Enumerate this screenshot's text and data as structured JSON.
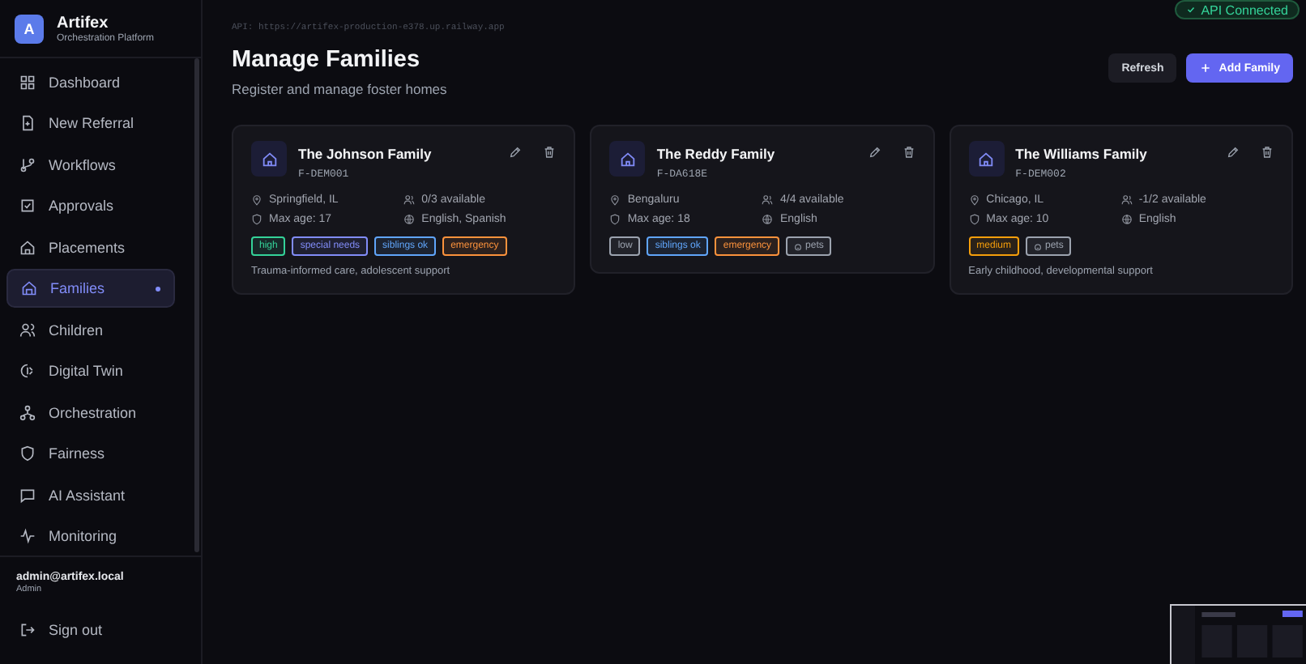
{
  "brand": {
    "letter": "A",
    "name": "Artifex",
    "subtitle": "Orchestration Platform"
  },
  "nav": [
    {
      "label": "Dashboard",
      "selected": false
    },
    {
      "label": "New Referral",
      "selected": false
    },
    {
      "label": "Workflows",
      "selected": false
    },
    {
      "label": "Approvals",
      "selected": false
    },
    {
      "label": "Placements",
      "selected": false
    },
    {
      "label": "Families",
      "selected": true
    },
    {
      "label": "Children",
      "selected": false
    },
    {
      "label": "Digital Twin",
      "selected": false
    },
    {
      "label": "Orchestration",
      "selected": false
    },
    {
      "label": "Fairness",
      "selected": false
    },
    {
      "label": "AI Assistant",
      "selected": false
    },
    {
      "label": "Monitoring",
      "selected": false
    }
  ],
  "user": {
    "email": "admin@artifex.local",
    "role": "Admin"
  },
  "sign_out": "Sign out",
  "api_url": "API: https://artifex-production-e378.up.railway.app",
  "api_status": "API Connected",
  "page": {
    "title": "Manage Families",
    "subtitle": "Register and manage foster homes"
  },
  "buttons": {
    "refresh": "Refresh",
    "add": "Add Family"
  },
  "families": [
    {
      "name": "The Johnson Family",
      "code": "F-DEM001",
      "location": "Springfield, IL",
      "availability": "0/3 available",
      "max_age": "Max age: 17",
      "languages": "English, Spanish",
      "tags": [
        {
          "label": "high",
          "color": "#34d399",
          "kind": "plain"
        },
        {
          "label": "special needs",
          "color": "#818cf8",
          "kind": "plain"
        },
        {
          "label": "siblings ok",
          "color": "#60a5fa",
          "kind": "plain"
        },
        {
          "label": "emergency",
          "color": "#fb923c",
          "kind": "plain"
        }
      ],
      "note": "Trauma-informed care, adolescent support"
    },
    {
      "name": "The Reddy Family",
      "code": "F-DA618E",
      "location": "Bengaluru",
      "availability": "4/4 available",
      "max_age": "Max age: 18",
      "languages": "English",
      "tags": [
        {
          "label": "low",
          "color": "#9ca3af",
          "kind": "plain"
        },
        {
          "label": "siblings ok",
          "color": "#60a5fa",
          "kind": "plain"
        },
        {
          "label": "emergency",
          "color": "#fb923c",
          "kind": "plain"
        },
        {
          "label": "pets",
          "color": "#9ca3af",
          "kind": "pets"
        }
      ]
    },
    {
      "name": "The Williams Family",
      "code": "F-DEM002",
      "location": "Chicago, IL",
      "availability": "-1/2 available",
      "max_age": "Max age: 10",
      "languages": "English",
      "tags": [
        {
          "label": "medium",
          "color": "#f59e0b",
          "kind": "plain"
        },
        {
          "label": "pets",
          "color": "#9ca3af",
          "kind": "pets"
        }
      ],
      "note": "Early childhood, developmental support"
    }
  ]
}
